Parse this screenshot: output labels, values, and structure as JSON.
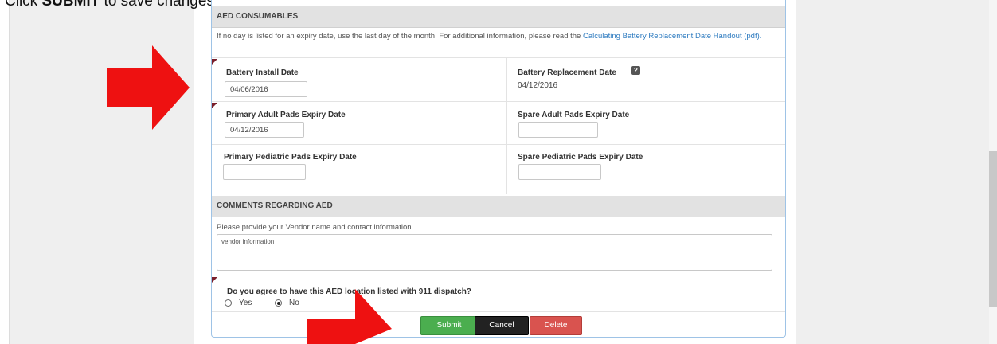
{
  "caption": {
    "prefix": "Click ",
    "bold": "SUBMIT",
    "suffix": " to save changes"
  },
  "consumables": {
    "header": "AED CONSUMABLES",
    "note_text": "If no day is listed for an expiry date, use the last day of the month. For additional information, please read the ",
    "note_link": "Calculating Battery Replacement Date Handout (pdf).",
    "battery_install_label": "Battery Install Date",
    "battery_install_value": "04/06/2016",
    "battery_replacement_label": "Battery Replacement Date",
    "battery_replacement_value": "04/12/2016",
    "primary_adult_label": "Primary Adult Pads Expiry Date",
    "primary_adult_value": "04/12/2016",
    "spare_adult_label": "Spare Adult Pads Expiry Date",
    "spare_adult_value": "",
    "primary_pediatric_label": "Primary Pediatric Pads Expiry Date",
    "primary_pediatric_value": "",
    "spare_pediatric_label": "Spare Pediatric Pads Expiry Date",
    "spare_pediatric_value": ""
  },
  "comments": {
    "header": "COMMENTS REGARDING AED",
    "prompt": "Please provide your Vendor name and contact information",
    "value": "vendor information"
  },
  "dispatch": {
    "question": "Do you agree to have this AED location listed with 911 dispatch?",
    "yes_label": "Yes",
    "no_label": "No",
    "selected": "No"
  },
  "buttons": {
    "submit": "Submit",
    "cancel": "Cancel",
    "delete": "Delete"
  },
  "icons": {
    "help": "help-icon",
    "arrow": "red-arrow-icon"
  },
  "colors": {
    "submit": "#4bae4f",
    "cancel": "#222222",
    "delete": "#d9534f",
    "arrow": "#ee1111",
    "link": "#2f7cc0"
  }
}
